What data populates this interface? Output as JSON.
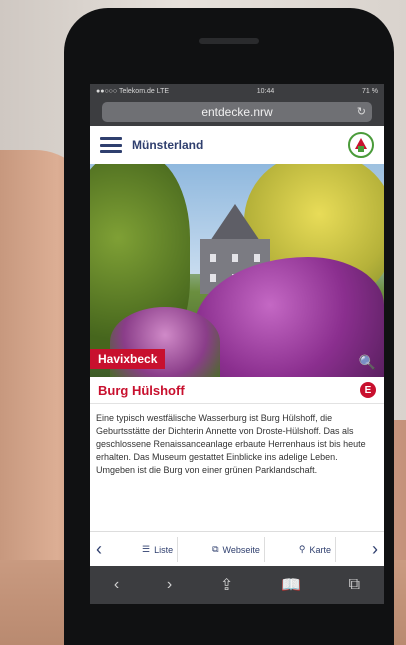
{
  "status_bar": {
    "carrier": "●●○○○ Telekom.de LTE",
    "time": "10:44",
    "battery": "71 %"
  },
  "browser": {
    "url": "entdecke.nrw",
    "reload_icon": "reload-icon"
  },
  "app_header": {
    "brand": "Münsterland",
    "menu_icon": "hamburger-menu-icon",
    "logo_icon": "nrw-logo-icon"
  },
  "hero": {
    "location_badge": "Havixbeck",
    "zoom_icon": "search-icon"
  },
  "content": {
    "title": "Burg Hülshoff",
    "title_badge": "E",
    "description": "Eine typisch westfälische Wasserburg ist Burg Hülshoff, die Geburtsstätte der Dichterin Annette von Droste-Hülshoff. Das als geschlossene Renaissanceanlage erbaute Herrenhaus ist bis heute erhalten. Das Museum gestattet Einblicke ins adelige Leben. Umgeben ist die Burg von einer grünen Parklandschaft."
  },
  "tab_bar": {
    "prev": "‹",
    "next": "›",
    "list_label": "Liste",
    "website_label": "Webseite",
    "map_label": "Karte"
  },
  "safari_toolbar": {
    "back": "‹",
    "forward": "›",
    "share": "⇪",
    "bookmarks": "📖",
    "tabs": "⧉"
  },
  "colors": {
    "brand_blue": "#2f3f6e",
    "accent_red": "#c8102e",
    "chrome_dark": "#3c3d40"
  }
}
